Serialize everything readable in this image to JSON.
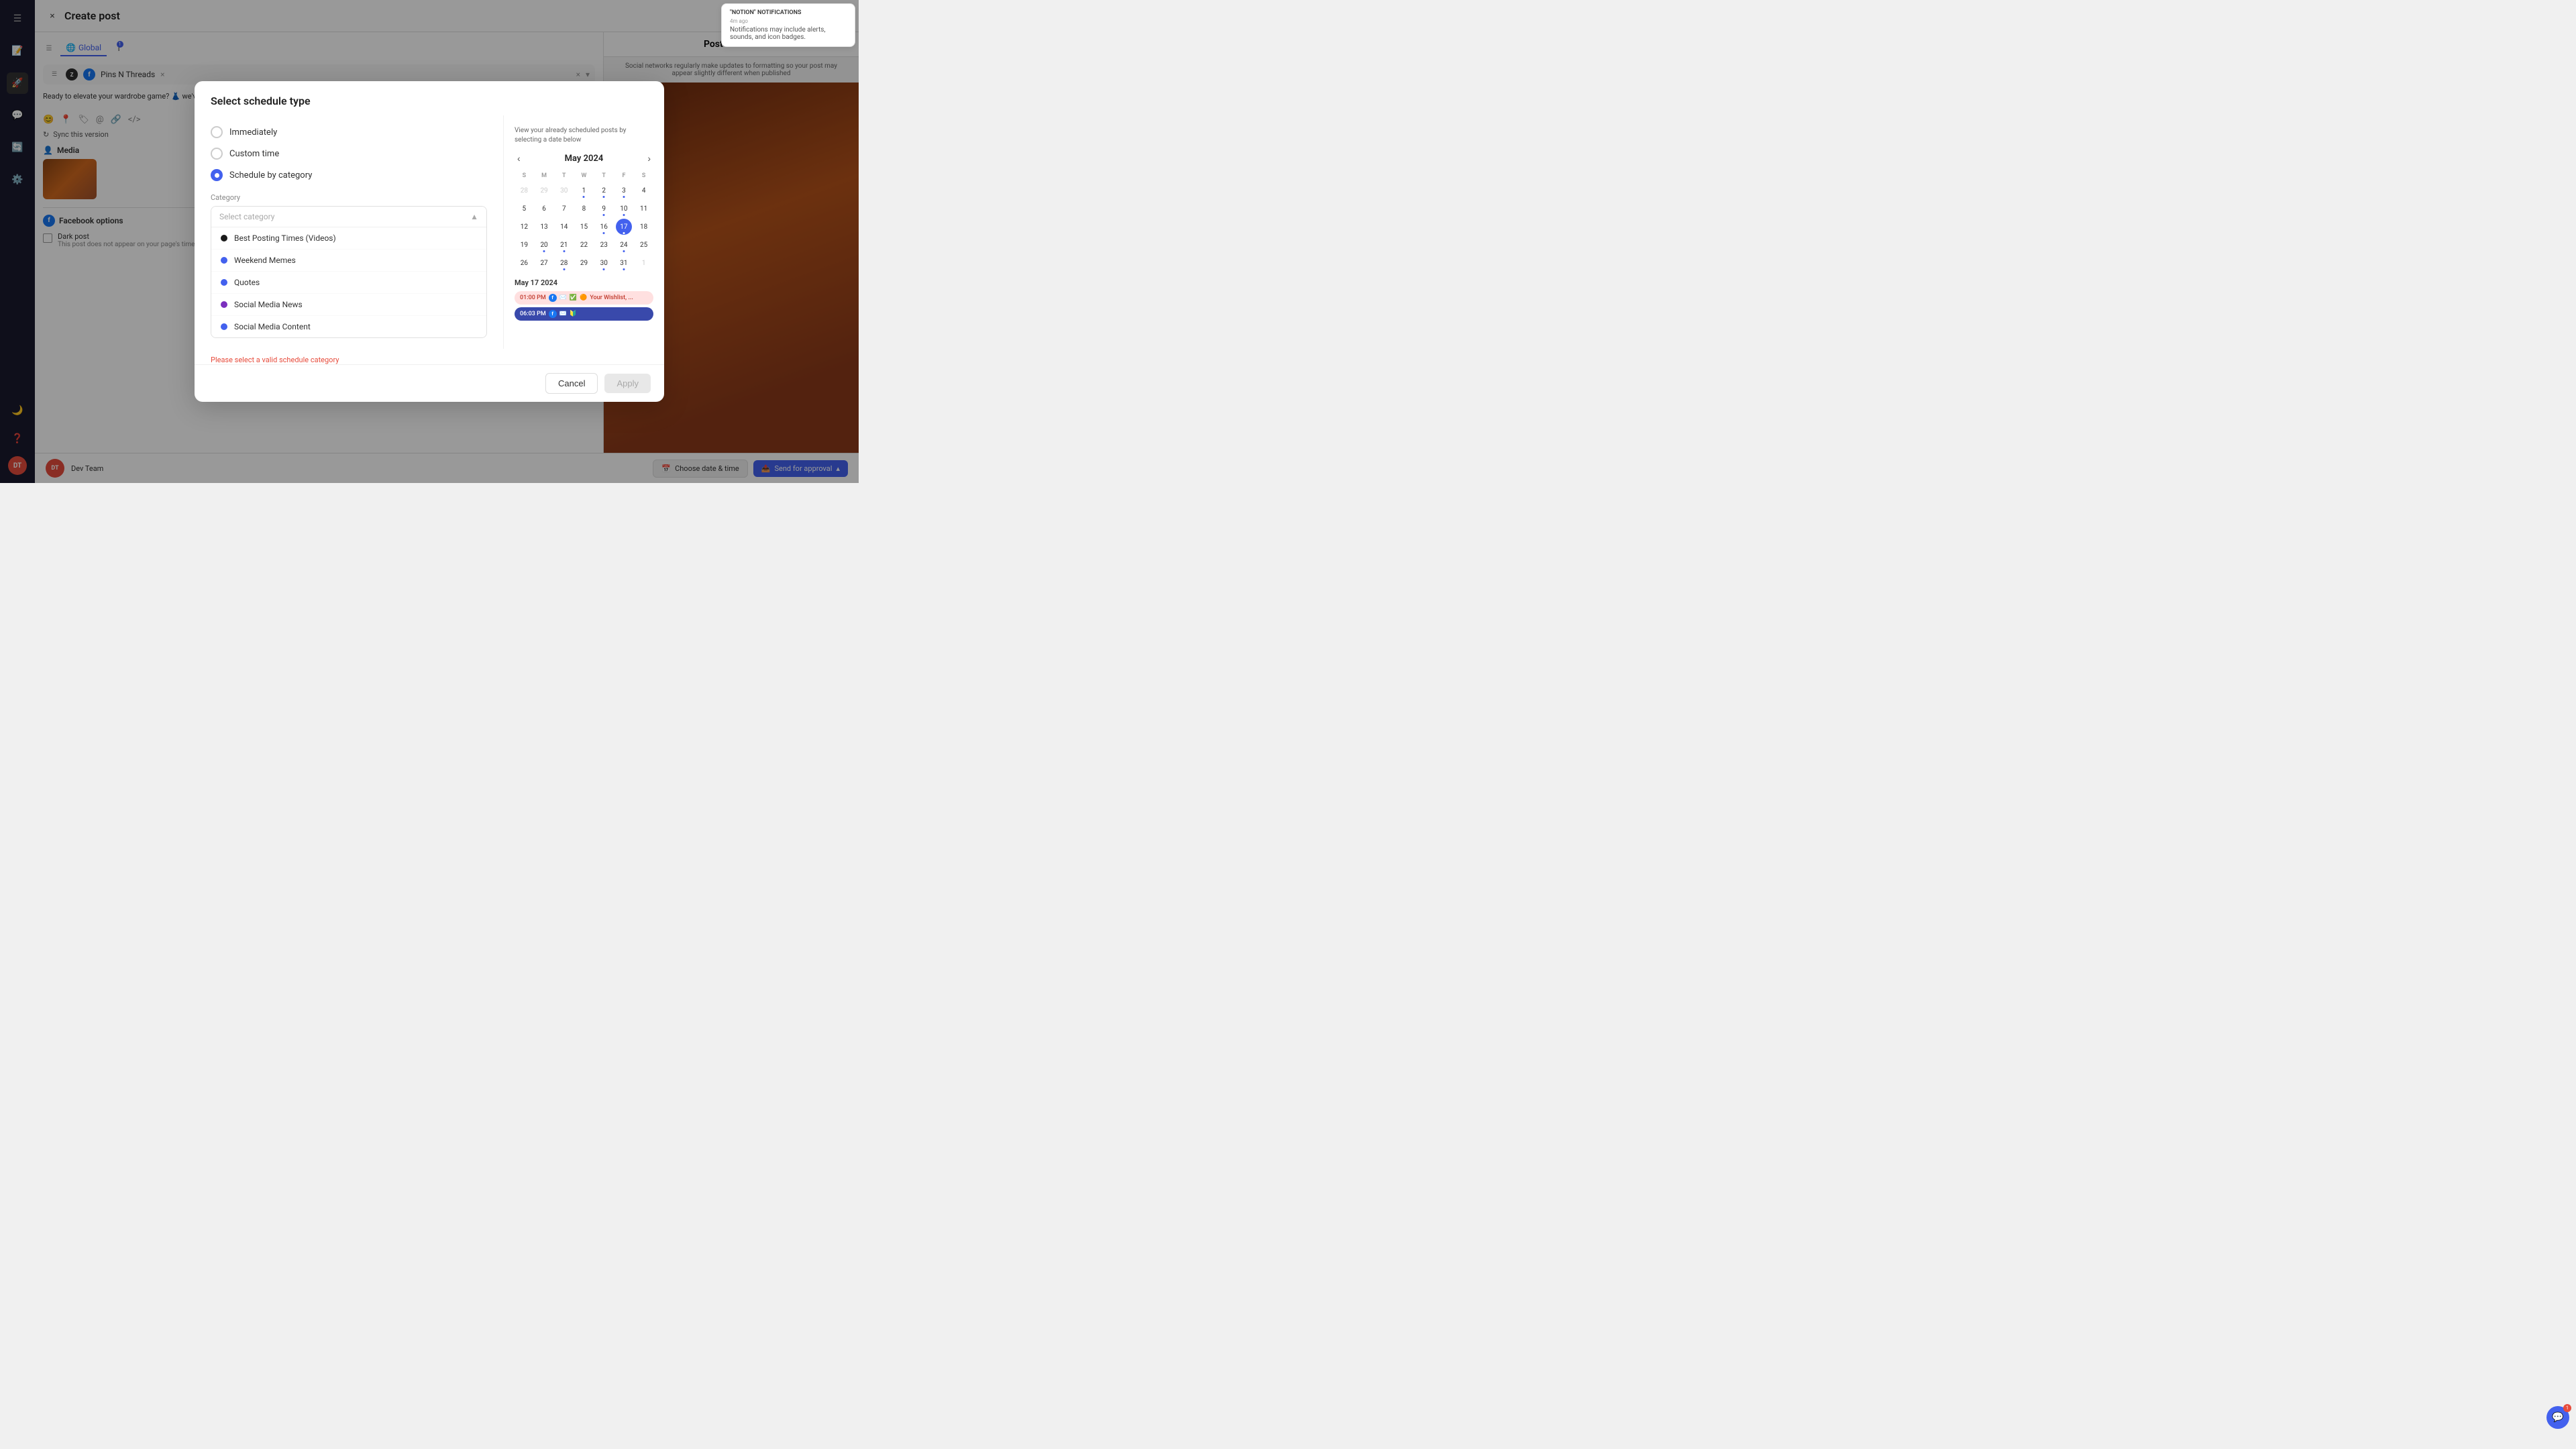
{
  "header": {
    "close_label": "×",
    "title": "Create post"
  },
  "notification": {
    "app": "\"NOTION\" NOTIFICATIONS",
    "time": "4m ago",
    "text": "Notifications may include alerts, sounds, and icon badges."
  },
  "tabs": {
    "global": "Global",
    "facebook_badge": "1"
  },
  "accounts": {
    "name": "Pins N Threads",
    "close": "×",
    "expand": "▾"
  },
  "post_text": "Ready to elevate your wardrobe game? 👗 we've got your fashion fix covered. Find your Pins n Threads today! ✨ #PinsnThreads #FashionForward #StyleGoa...",
  "sync_label": "Sync this version",
  "media_label": "Media",
  "facebook_options": {
    "label": "Facebook options",
    "dark_post": "Dark post",
    "dark_post_sub": "This post does not appear on your page's timeline or in the feeds of your followers"
  },
  "preview": {
    "title": "Post Preview",
    "note": "Social networks regularly make updates to formatting so your post may appear slightly different when published"
  },
  "bottom_bar": {
    "team": "Dev Team",
    "team_initials": "DT",
    "date_btn": "Choose date & time",
    "send_btn": "Send for approval"
  },
  "modal": {
    "title": "Select schedule type",
    "options": [
      {
        "id": "immediately",
        "label": "Immediately",
        "checked": false
      },
      {
        "id": "custom_time",
        "label": "Custom time",
        "checked": false
      },
      {
        "id": "schedule_by_category",
        "label": "Schedule by category",
        "checked": true
      }
    ],
    "category_label": "Category",
    "category_placeholder": "Select category",
    "categories": [
      {
        "label": "Best Posting Times (Videos)",
        "color": "#1a1a1a",
        "type": "dark"
      },
      {
        "label": "Weekend Memes",
        "color": "#4361ee",
        "type": "blue"
      },
      {
        "label": "Quotes",
        "color": "#4361ee",
        "type": "blue"
      },
      {
        "label": "Social Media News",
        "color": "#7B2FBE",
        "type": "purple"
      },
      {
        "label": "Social Media Content",
        "color": "#4361ee",
        "type": "blue"
      }
    ],
    "error_msg": "Please select a valid schedule category",
    "cancel_label": "Cancel",
    "apply_label": "Apply",
    "calendar": {
      "month": "May",
      "year": "2024",
      "info": "View your already scheduled posts by selecting a date below",
      "day_headers": [
        "S",
        "M",
        "T",
        "W",
        "T",
        "F",
        "S"
      ],
      "weeks": [
        [
          {
            "day": 28,
            "other": true,
            "dot": false
          },
          {
            "day": 29,
            "other": true,
            "dot": false
          },
          {
            "day": 30,
            "other": true,
            "dot": false
          },
          {
            "day": 1,
            "other": false,
            "dot": true
          },
          {
            "day": 2,
            "other": false,
            "dot": true
          },
          {
            "day": 3,
            "other": false,
            "dot": true
          },
          {
            "day": 4,
            "other": false,
            "dot": false
          }
        ],
        [
          {
            "day": 5,
            "other": false,
            "dot": false
          },
          {
            "day": 6,
            "other": false,
            "dot": false
          },
          {
            "day": 7,
            "other": false,
            "dot": false
          },
          {
            "day": 8,
            "other": false,
            "dot": false
          },
          {
            "day": 9,
            "other": false,
            "dot": true
          },
          {
            "day": 10,
            "other": false,
            "dot": true
          },
          {
            "day": 11,
            "other": false,
            "dot": false
          }
        ],
        [
          {
            "day": 12,
            "other": false,
            "dot": false
          },
          {
            "day": 13,
            "other": false,
            "dot": false
          },
          {
            "day": 14,
            "other": false,
            "dot": false
          },
          {
            "day": 15,
            "other": false,
            "dot": false
          },
          {
            "day": 16,
            "other": false,
            "dot": true
          },
          {
            "day": 17,
            "other": false,
            "today": true,
            "dot": true
          },
          {
            "day": 18,
            "other": false,
            "dot": false
          }
        ],
        [
          {
            "day": 19,
            "other": false,
            "dot": false
          },
          {
            "day": 20,
            "other": false,
            "dot": true
          },
          {
            "day": 21,
            "other": false,
            "dot": true
          },
          {
            "day": 22,
            "other": false,
            "dot": false
          },
          {
            "day": 23,
            "other": false,
            "dot": false
          },
          {
            "day": 24,
            "other": false,
            "dot": true
          },
          {
            "day": 25,
            "other": false,
            "dot": false
          }
        ],
        [
          {
            "day": 26,
            "other": false,
            "dot": false
          },
          {
            "day": 27,
            "other": false,
            "dot": false
          },
          {
            "day": 28,
            "other": false,
            "dot": true
          },
          {
            "day": 29,
            "other": false,
            "dot": false
          },
          {
            "day": 30,
            "other": false,
            "dot": true
          },
          {
            "day": 31,
            "other": false,
            "dot": true
          },
          {
            "day": 1,
            "other": true,
            "dot": false
          }
        ]
      ],
      "selected_date": "May 17 2024",
      "posts": [
        {
          "time": "01:00 PM",
          "color": "pink",
          "emoji": "✅🟠",
          "text": "Your Wishlist, ..."
        },
        {
          "time": "06:03 PM",
          "color": "blue",
          "emoji": "🔰",
          "text": ""
        }
      ]
    }
  }
}
